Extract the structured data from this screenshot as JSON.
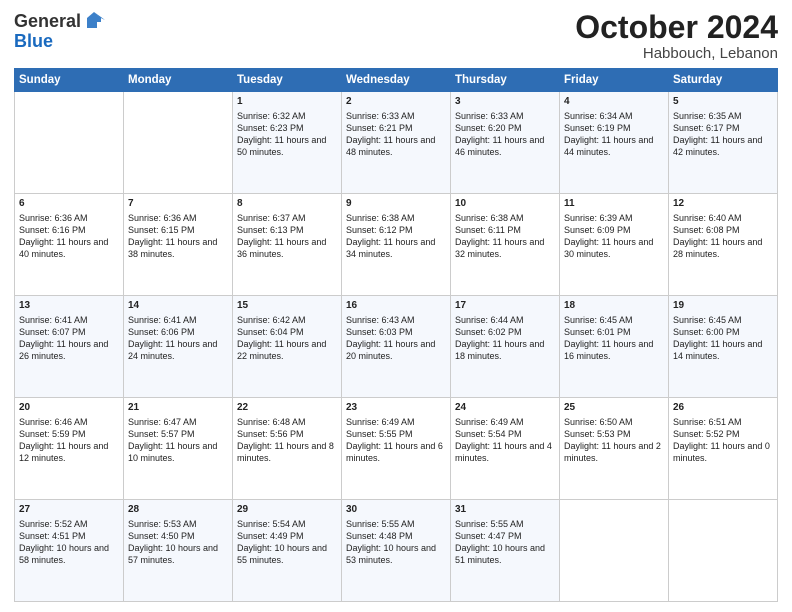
{
  "header": {
    "logo_general": "General",
    "logo_blue": "Blue",
    "month": "October 2024",
    "location": "Habbouch, Lebanon"
  },
  "weekdays": [
    "Sunday",
    "Monday",
    "Tuesday",
    "Wednesday",
    "Thursday",
    "Friday",
    "Saturday"
  ],
  "weeks": [
    [
      {
        "day": "",
        "sunrise": "",
        "sunset": "",
        "daylight": ""
      },
      {
        "day": "",
        "sunrise": "",
        "sunset": "",
        "daylight": ""
      },
      {
        "day": "1",
        "sunrise": "Sunrise: 6:32 AM",
        "sunset": "Sunset: 6:23 PM",
        "daylight": "Daylight: 11 hours and 50 minutes."
      },
      {
        "day": "2",
        "sunrise": "Sunrise: 6:33 AM",
        "sunset": "Sunset: 6:21 PM",
        "daylight": "Daylight: 11 hours and 48 minutes."
      },
      {
        "day": "3",
        "sunrise": "Sunrise: 6:33 AM",
        "sunset": "Sunset: 6:20 PM",
        "daylight": "Daylight: 11 hours and 46 minutes."
      },
      {
        "day": "4",
        "sunrise": "Sunrise: 6:34 AM",
        "sunset": "Sunset: 6:19 PM",
        "daylight": "Daylight: 11 hours and 44 minutes."
      },
      {
        "day": "5",
        "sunrise": "Sunrise: 6:35 AM",
        "sunset": "Sunset: 6:17 PM",
        "daylight": "Daylight: 11 hours and 42 minutes."
      }
    ],
    [
      {
        "day": "6",
        "sunrise": "Sunrise: 6:36 AM",
        "sunset": "Sunset: 6:16 PM",
        "daylight": "Daylight: 11 hours and 40 minutes."
      },
      {
        "day": "7",
        "sunrise": "Sunrise: 6:36 AM",
        "sunset": "Sunset: 6:15 PM",
        "daylight": "Daylight: 11 hours and 38 minutes."
      },
      {
        "day": "8",
        "sunrise": "Sunrise: 6:37 AM",
        "sunset": "Sunset: 6:13 PM",
        "daylight": "Daylight: 11 hours and 36 minutes."
      },
      {
        "day": "9",
        "sunrise": "Sunrise: 6:38 AM",
        "sunset": "Sunset: 6:12 PM",
        "daylight": "Daylight: 11 hours and 34 minutes."
      },
      {
        "day": "10",
        "sunrise": "Sunrise: 6:38 AM",
        "sunset": "Sunset: 6:11 PM",
        "daylight": "Daylight: 11 hours and 32 minutes."
      },
      {
        "day": "11",
        "sunrise": "Sunrise: 6:39 AM",
        "sunset": "Sunset: 6:09 PM",
        "daylight": "Daylight: 11 hours and 30 minutes."
      },
      {
        "day": "12",
        "sunrise": "Sunrise: 6:40 AM",
        "sunset": "Sunset: 6:08 PM",
        "daylight": "Daylight: 11 hours and 28 minutes."
      }
    ],
    [
      {
        "day": "13",
        "sunrise": "Sunrise: 6:41 AM",
        "sunset": "Sunset: 6:07 PM",
        "daylight": "Daylight: 11 hours and 26 minutes."
      },
      {
        "day": "14",
        "sunrise": "Sunrise: 6:41 AM",
        "sunset": "Sunset: 6:06 PM",
        "daylight": "Daylight: 11 hours and 24 minutes."
      },
      {
        "day": "15",
        "sunrise": "Sunrise: 6:42 AM",
        "sunset": "Sunset: 6:04 PM",
        "daylight": "Daylight: 11 hours and 22 minutes."
      },
      {
        "day": "16",
        "sunrise": "Sunrise: 6:43 AM",
        "sunset": "Sunset: 6:03 PM",
        "daylight": "Daylight: 11 hours and 20 minutes."
      },
      {
        "day": "17",
        "sunrise": "Sunrise: 6:44 AM",
        "sunset": "Sunset: 6:02 PM",
        "daylight": "Daylight: 11 hours and 18 minutes."
      },
      {
        "day": "18",
        "sunrise": "Sunrise: 6:45 AM",
        "sunset": "Sunset: 6:01 PM",
        "daylight": "Daylight: 11 hours and 16 minutes."
      },
      {
        "day": "19",
        "sunrise": "Sunrise: 6:45 AM",
        "sunset": "Sunset: 6:00 PM",
        "daylight": "Daylight: 11 hours and 14 minutes."
      }
    ],
    [
      {
        "day": "20",
        "sunrise": "Sunrise: 6:46 AM",
        "sunset": "Sunset: 5:59 PM",
        "daylight": "Daylight: 11 hours and 12 minutes."
      },
      {
        "day": "21",
        "sunrise": "Sunrise: 6:47 AM",
        "sunset": "Sunset: 5:57 PM",
        "daylight": "Daylight: 11 hours and 10 minutes."
      },
      {
        "day": "22",
        "sunrise": "Sunrise: 6:48 AM",
        "sunset": "Sunset: 5:56 PM",
        "daylight": "Daylight: 11 hours and 8 minutes."
      },
      {
        "day": "23",
        "sunrise": "Sunrise: 6:49 AM",
        "sunset": "Sunset: 5:55 PM",
        "daylight": "Daylight: 11 hours and 6 minutes."
      },
      {
        "day": "24",
        "sunrise": "Sunrise: 6:49 AM",
        "sunset": "Sunset: 5:54 PM",
        "daylight": "Daylight: 11 hours and 4 minutes."
      },
      {
        "day": "25",
        "sunrise": "Sunrise: 6:50 AM",
        "sunset": "Sunset: 5:53 PM",
        "daylight": "Daylight: 11 hours and 2 minutes."
      },
      {
        "day": "26",
        "sunrise": "Sunrise: 6:51 AM",
        "sunset": "Sunset: 5:52 PM",
        "daylight": "Daylight: 11 hours and 0 minutes."
      }
    ],
    [
      {
        "day": "27",
        "sunrise": "Sunrise: 5:52 AM",
        "sunset": "Sunset: 4:51 PM",
        "daylight": "Daylight: 10 hours and 58 minutes."
      },
      {
        "day": "28",
        "sunrise": "Sunrise: 5:53 AM",
        "sunset": "Sunset: 4:50 PM",
        "daylight": "Daylight: 10 hours and 57 minutes."
      },
      {
        "day": "29",
        "sunrise": "Sunrise: 5:54 AM",
        "sunset": "Sunset: 4:49 PM",
        "daylight": "Daylight: 10 hours and 55 minutes."
      },
      {
        "day": "30",
        "sunrise": "Sunrise: 5:55 AM",
        "sunset": "Sunset: 4:48 PM",
        "daylight": "Daylight: 10 hours and 53 minutes."
      },
      {
        "day": "31",
        "sunrise": "Sunrise: 5:55 AM",
        "sunset": "Sunset: 4:47 PM",
        "daylight": "Daylight: 10 hours and 51 minutes."
      },
      {
        "day": "",
        "sunrise": "",
        "sunset": "",
        "daylight": ""
      },
      {
        "day": "",
        "sunrise": "",
        "sunset": "",
        "daylight": ""
      }
    ]
  ]
}
